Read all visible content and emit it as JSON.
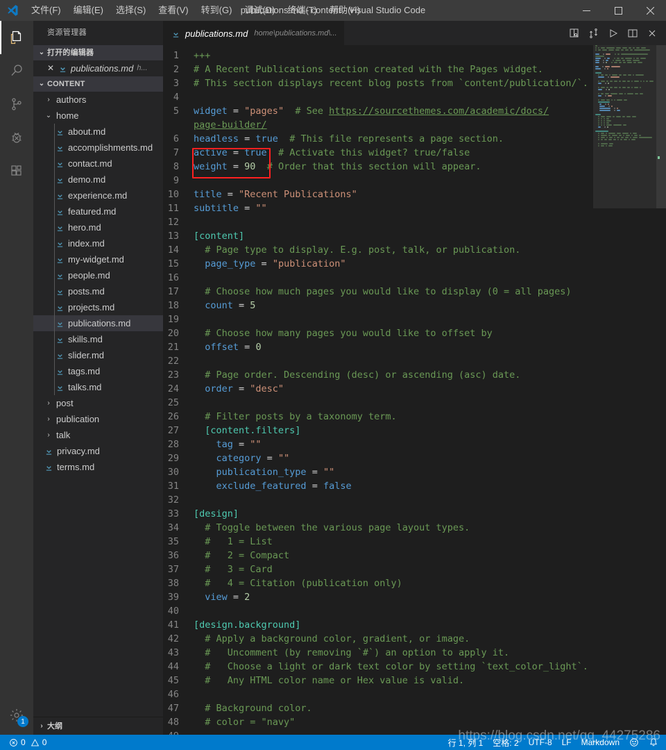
{
  "titlebar": {
    "logo_icon": "vscode-logo",
    "menus": [
      {
        "label": "文件(F)",
        "name": "menu-file"
      },
      {
        "label": "编辑(E)",
        "name": "menu-edit"
      },
      {
        "label": "选择(S)",
        "name": "menu-selection"
      },
      {
        "label": "查看(V)",
        "name": "menu-view"
      },
      {
        "label": "转到(G)",
        "name": "menu-goto"
      },
      {
        "label": "调试(D)",
        "name": "menu-debug"
      },
      {
        "label": "终端(T)",
        "name": "menu-terminal"
      },
      {
        "label": "帮助(H)",
        "name": "menu-help"
      }
    ],
    "window_title": "publications.md - content - Visual Studio Code",
    "minimize": "—",
    "maximize": "▢",
    "close": "✕"
  },
  "activitybar": {
    "items": [
      {
        "name": "activity-explorer",
        "icon": "files-icon",
        "active": true
      },
      {
        "name": "activity-search",
        "icon": "search-icon",
        "active": false
      },
      {
        "name": "activity-source-control",
        "icon": "source-control-icon",
        "active": false
      },
      {
        "name": "activity-debug",
        "icon": "debug-icon",
        "active": false
      },
      {
        "name": "activity-extensions",
        "icon": "extensions-icon",
        "active": false
      }
    ],
    "settings": {
      "name": "activity-settings",
      "icon": "gear-icon",
      "badge": "1"
    }
  },
  "sidebar": {
    "title": "资源管理器",
    "open_editors": {
      "label": "打开的编辑器",
      "twisty": "⌄",
      "items": [
        {
          "name": "open-editor-publications",
          "close": "✕",
          "label": "publications.md",
          "sub": "h..."
        }
      ]
    },
    "content_section": {
      "label": "CONTENT",
      "twisty": "⌄"
    },
    "tree": [
      {
        "label": "authors",
        "type": "folder",
        "twisty": "›",
        "indent": 1,
        "selected": false
      },
      {
        "label": "home",
        "type": "folder",
        "twisty": "⌄",
        "indent": 1,
        "selected": false
      },
      {
        "label": "about.md",
        "type": "file",
        "indent": 2,
        "selected": false
      },
      {
        "label": "accomplishments.md",
        "type": "file",
        "indent": 2,
        "selected": false
      },
      {
        "label": "contact.md",
        "type": "file",
        "indent": 2,
        "selected": false
      },
      {
        "label": "demo.md",
        "type": "file",
        "indent": 2,
        "selected": false
      },
      {
        "label": "experience.md",
        "type": "file",
        "indent": 2,
        "selected": false
      },
      {
        "label": "featured.md",
        "type": "file",
        "indent": 2,
        "selected": false
      },
      {
        "label": "hero.md",
        "type": "file",
        "indent": 2,
        "selected": false
      },
      {
        "label": "index.md",
        "type": "file",
        "indent": 2,
        "selected": false
      },
      {
        "label": "my-widget.md",
        "type": "file",
        "indent": 2,
        "selected": false
      },
      {
        "label": "people.md",
        "type": "file",
        "indent": 2,
        "selected": false
      },
      {
        "label": "posts.md",
        "type": "file",
        "indent": 2,
        "selected": false
      },
      {
        "label": "projects.md",
        "type": "file",
        "indent": 2,
        "selected": false
      },
      {
        "label": "publications.md",
        "type": "file",
        "indent": 2,
        "selected": true
      },
      {
        "label": "skills.md",
        "type": "file",
        "indent": 2,
        "selected": false
      },
      {
        "label": "slider.md",
        "type": "file",
        "indent": 2,
        "selected": false
      },
      {
        "label": "tags.md",
        "type": "file",
        "indent": 2,
        "selected": false
      },
      {
        "label": "talks.md",
        "type": "file",
        "indent": 2,
        "selected": false
      },
      {
        "label": "post",
        "type": "folder",
        "twisty": "›",
        "indent": 1,
        "selected": false
      },
      {
        "label": "publication",
        "type": "folder",
        "twisty": "›",
        "indent": 1,
        "selected": false
      },
      {
        "label": "talk",
        "type": "folder",
        "twisty": "›",
        "indent": 1,
        "selected": false
      },
      {
        "label": "privacy.md",
        "type": "file",
        "indent": 1,
        "selected": false
      },
      {
        "label": "terms.md",
        "type": "file",
        "indent": 1,
        "selected": false
      }
    ],
    "outline": {
      "label": "大纲",
      "twisty": "›"
    }
  },
  "editor": {
    "tab": {
      "label": "publications.md",
      "path": "home\\publications.md\\...",
      "icon": "markdown-file-icon"
    },
    "actions": [
      {
        "name": "open-preview-button",
        "icon": "preview-icon"
      },
      {
        "name": "open-changes-button",
        "icon": "compare-changes-icon"
      },
      {
        "name": "run-button",
        "icon": "play-icon"
      },
      {
        "name": "split-editor-button",
        "icon": "split-editor-icon"
      },
      {
        "name": "close-editor-button",
        "icon": "close-icon"
      }
    ],
    "annotation": {
      "color": "#ff2020",
      "covers_lines": [
        7,
        8
      ]
    },
    "lines": [
      {
        "n": "1",
        "tokens": [
          {
            "t": "+++",
            "c": "c"
          }
        ]
      },
      {
        "n": "2",
        "tokens": [
          {
            "t": "# A Recent Publications section created with the Pages widget.",
            "c": "c"
          }
        ]
      },
      {
        "n": "3",
        "tokens": [
          {
            "t": "# This section displays recent blog posts from `content/publication/`.",
            "c": "c"
          }
        ]
      },
      {
        "n": "4",
        "tokens": []
      },
      {
        "n": "5",
        "tokens": [
          {
            "t": "widget",
            "c": "k"
          },
          {
            "t": " = ",
            "c": "op"
          },
          {
            "t": "\"pages\"",
            "c": "s"
          },
          {
            "t": "  # See ",
            "c": "c"
          },
          {
            "t": "https://sourcethemes.com/academic/docs/",
            "c": "lnk"
          }
        ]
      },
      {
        "n": "",
        "wrap": true,
        "tokens": [
          {
            "t": "page-builder/",
            "c": "lnk"
          }
        ]
      },
      {
        "n": "6",
        "tokens": [
          {
            "t": "headless",
            "c": "k"
          },
          {
            "t": " = ",
            "c": "op"
          },
          {
            "t": "true",
            "c": "b"
          },
          {
            "t": "  # This file represents a page section.",
            "c": "c"
          }
        ]
      },
      {
        "n": "7",
        "tokens": [
          {
            "t": "active",
            "c": "k"
          },
          {
            "t": " = ",
            "c": "op"
          },
          {
            "t": "true",
            "c": "b"
          },
          {
            "t": "  # Activate this widget? true/false",
            "c": "c"
          }
        ]
      },
      {
        "n": "8",
        "tokens": [
          {
            "t": "weight",
            "c": "k"
          },
          {
            "t": " = ",
            "c": "op"
          },
          {
            "t": "90",
            "c": "n"
          },
          {
            "t": "  # Order that this section will appear.",
            "c": "c"
          }
        ]
      },
      {
        "n": "9",
        "tokens": []
      },
      {
        "n": "10",
        "tokens": [
          {
            "t": "title",
            "c": "k"
          },
          {
            "t": " = ",
            "c": "op"
          },
          {
            "t": "\"Recent Publications\"",
            "c": "s"
          }
        ]
      },
      {
        "n": "11",
        "tokens": [
          {
            "t": "subtitle",
            "c": "k"
          },
          {
            "t": " = ",
            "c": "op"
          },
          {
            "t": "\"\"",
            "c": "s"
          }
        ]
      },
      {
        "n": "12",
        "tokens": []
      },
      {
        "n": "13",
        "tokens": [
          {
            "t": "[content]",
            "c": "sec"
          }
        ]
      },
      {
        "n": "14",
        "tokens": [
          {
            "t": "  # Page type to display. E.g. post, talk, or publication.",
            "c": "c"
          }
        ]
      },
      {
        "n": "15",
        "tokens": [
          {
            "t": "  ",
            "c": "op"
          },
          {
            "t": "page_type",
            "c": "k"
          },
          {
            "t": " = ",
            "c": "op"
          },
          {
            "t": "\"publication\"",
            "c": "s"
          }
        ]
      },
      {
        "n": "16",
        "tokens": []
      },
      {
        "n": "17",
        "tokens": [
          {
            "t": "  # Choose how much pages you would like to display (0 = all pages)",
            "c": "c"
          }
        ]
      },
      {
        "n": "18",
        "tokens": [
          {
            "t": "  ",
            "c": "op"
          },
          {
            "t": "count",
            "c": "k"
          },
          {
            "t": " = ",
            "c": "op"
          },
          {
            "t": "5",
            "c": "n"
          }
        ]
      },
      {
        "n": "19",
        "tokens": []
      },
      {
        "n": "20",
        "tokens": [
          {
            "t": "  # Choose how many pages you would like to offset by",
            "c": "c"
          }
        ]
      },
      {
        "n": "21",
        "tokens": [
          {
            "t": "  ",
            "c": "op"
          },
          {
            "t": "offset",
            "c": "k"
          },
          {
            "t": " = ",
            "c": "op"
          },
          {
            "t": "0",
            "c": "n"
          }
        ]
      },
      {
        "n": "22",
        "tokens": []
      },
      {
        "n": "23",
        "tokens": [
          {
            "t": "  # Page order. Descending (desc) or ascending (asc) date.",
            "c": "c"
          }
        ]
      },
      {
        "n": "24",
        "tokens": [
          {
            "t": "  ",
            "c": "op"
          },
          {
            "t": "order",
            "c": "k"
          },
          {
            "t": " = ",
            "c": "op"
          },
          {
            "t": "\"desc\"",
            "c": "s"
          }
        ]
      },
      {
        "n": "25",
        "tokens": []
      },
      {
        "n": "26",
        "tokens": [
          {
            "t": "  # Filter posts by a taxonomy term.",
            "c": "c"
          }
        ]
      },
      {
        "n": "27",
        "tokens": [
          {
            "t": "  ",
            "c": "op"
          },
          {
            "t": "[content.filters]",
            "c": "sec"
          }
        ]
      },
      {
        "n": "28",
        "tokens": [
          {
            "t": "    ",
            "c": "op"
          },
          {
            "t": "tag",
            "c": "k"
          },
          {
            "t": " = ",
            "c": "op"
          },
          {
            "t": "\"\"",
            "c": "s"
          }
        ]
      },
      {
        "n": "29",
        "tokens": [
          {
            "t": "    ",
            "c": "op"
          },
          {
            "t": "category",
            "c": "k"
          },
          {
            "t": " = ",
            "c": "op"
          },
          {
            "t": "\"\"",
            "c": "s"
          }
        ]
      },
      {
        "n": "30",
        "tokens": [
          {
            "t": "    ",
            "c": "op"
          },
          {
            "t": "publication_type",
            "c": "k"
          },
          {
            "t": " = ",
            "c": "op"
          },
          {
            "t": "\"\"",
            "c": "s"
          }
        ]
      },
      {
        "n": "31",
        "tokens": [
          {
            "t": "    ",
            "c": "op"
          },
          {
            "t": "exclude_featured",
            "c": "k"
          },
          {
            "t": " = ",
            "c": "op"
          },
          {
            "t": "false",
            "c": "b"
          }
        ]
      },
      {
        "n": "32",
        "tokens": []
      },
      {
        "n": "33",
        "tokens": [
          {
            "t": "[design]",
            "c": "sec"
          }
        ]
      },
      {
        "n": "34",
        "tokens": [
          {
            "t": "  # Toggle between the various page layout types.",
            "c": "c"
          }
        ]
      },
      {
        "n": "35",
        "tokens": [
          {
            "t": "  #   1 = List",
            "c": "c"
          }
        ]
      },
      {
        "n": "36",
        "tokens": [
          {
            "t": "  #   2 = Compact",
            "c": "c"
          }
        ]
      },
      {
        "n": "37",
        "tokens": [
          {
            "t": "  #   3 = Card",
            "c": "c"
          }
        ]
      },
      {
        "n": "38",
        "tokens": [
          {
            "t": "  #   4 = Citation (publication only)",
            "c": "c"
          }
        ]
      },
      {
        "n": "39",
        "tokens": [
          {
            "t": "  ",
            "c": "op"
          },
          {
            "t": "view",
            "c": "k"
          },
          {
            "t": " = ",
            "c": "op"
          },
          {
            "t": "2",
            "c": "n"
          }
        ]
      },
      {
        "n": "40",
        "tokens": []
      },
      {
        "n": "41",
        "tokens": [
          {
            "t": "[design.background]",
            "c": "sec"
          }
        ]
      },
      {
        "n": "42",
        "tokens": [
          {
            "t": "  # Apply a background color, gradient, or image.",
            "c": "c"
          }
        ]
      },
      {
        "n": "43",
        "tokens": [
          {
            "t": "  #   Uncomment (by removing `#`) an option to apply it.",
            "c": "c"
          }
        ]
      },
      {
        "n": "44",
        "tokens": [
          {
            "t": "  #   Choose a light or dark text color by setting `text_color_light`.",
            "c": "c"
          }
        ]
      },
      {
        "n": "45",
        "tokens": [
          {
            "t": "  #   Any HTML color name or Hex value is valid.",
            "c": "c"
          }
        ]
      },
      {
        "n": "46",
        "tokens": []
      },
      {
        "n": "47",
        "tokens": [
          {
            "t": "  # Background color.",
            "c": "c"
          }
        ]
      },
      {
        "n": "48",
        "tokens": [
          {
            "t": "  # color = \"navy\"",
            "c": "c"
          }
        ]
      },
      {
        "n": "49",
        "tokens": []
      }
    ]
  },
  "statusbar": {
    "errors_icon": "error-circle-icon",
    "errors": "0",
    "warnings_icon": "warning-triangle-icon",
    "warnings": "0",
    "cursor_position": "行 1, 列 1",
    "indentation": "空格: 2",
    "encoding": "UTF-8",
    "eol": "LF",
    "language": "Markdown",
    "feedback_icon": "smiley-icon",
    "notifications_icon": "bell-icon",
    "watermark": "https://blog.csdn.net/qq_44275286"
  },
  "colors": {
    "accent": "#007acc",
    "annotation": "#ff2020",
    "editor_bg": "#1e1e1e",
    "sidebar_bg": "#252526",
    "activitybar_bg": "#333333",
    "titlebar_bg": "#3c3c3c"
  }
}
